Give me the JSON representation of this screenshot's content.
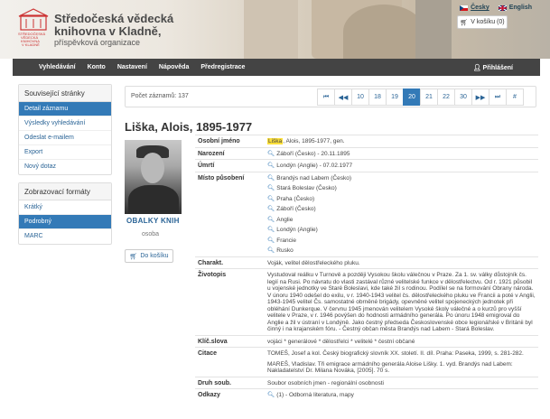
{
  "header": {
    "logo_line1": "Středočeská vědecká",
    "logo_line2": "knihovna v Kladně,",
    "logo_line3": "příspěvková organizace",
    "logo_small": "STŘEDOČESKÁ VĚDECKÁ KNIHOVNA V KLADNĚ",
    "lang_cs": "Česky",
    "lang_en": "English",
    "cart": "V košíku (0)"
  },
  "nav": {
    "items": [
      "Vyhledávání",
      "Konto",
      "Nastavení",
      "Nápověda",
      "Předregistrace"
    ],
    "login": "Přihlášení"
  },
  "sidebar": {
    "related_title": "Související stránky",
    "related": [
      "Detail záznamu",
      "Výsledky vyhledávání",
      "Odeslat e-mailem",
      "Export",
      "Nový dotaz"
    ],
    "formats_title": "Zobrazovací formáty",
    "formats": [
      "Krátký",
      "Podrobný",
      "MARC"
    ]
  },
  "results": {
    "count_text": "Počet záznamů: 137",
    "pages": [
      "10",
      "18",
      "19",
      "20",
      "21",
      "22",
      "30"
    ],
    "current_page": "20",
    "first": "⏮",
    "prev": "◀◀",
    "next": "▶▶",
    "last": "⏭",
    "hash": "#"
  },
  "record": {
    "title": "Liška, Alois, 1895-1977",
    "cover_label": "OBALKY KNIH",
    "type_label": "osoba",
    "add_cart": "Do košíku",
    "fields": {
      "name_label": "Osobní jméno",
      "name_hl": "Liška",
      "name_rest": ", Alois, 1895-1977, gen.",
      "birth_label": "Narození",
      "birth": "Záboří (Česko) - 20.11.1895",
      "death_label": "Úmrtí",
      "death": "Londýn (Anglie) - 07.02.1977",
      "places_label": "Místo působení",
      "places": [
        "Brandýs nad Labem (Česko)",
        "Stará Boleslav (Česko)",
        "Praha (Česko)",
        "Záboří (Česko)",
        "Anglie",
        "Londýn (Anglie)",
        "Francie",
        "Rusko"
      ],
      "charakt_label": "Charakt.",
      "charakt": "Voják, velitel dělostřeleckého pluku.",
      "bio_label": "Životopis",
      "bio": "Vystudoval reálku v Turnově a později Vysokou školu válečnou v Praze. Za 1. sv. války důstojník čs. legií na Rusi. Po návratu do vlasti zastával různé velitelské funkce v dělostřelectvu. Od r. 1921 působil u vojenské jednotky ve Staré Boleslavi, kde také žil s rodinou. Podílel se na formování Obrany národa. V únoru 1940 odešel do exilu, v r. 1940-1943 velitel čs. dělostřeleckého pluku ve Francii a poté v Anglii, 1943-1945 velitel Čs. samostatné obrněné brigády, opevněné velitel spojeneckých jednotek při obléhání Dunkerque. V červnu 1945 jmenován velitelem Vysoké školy válečné a o kurzů pro vyšší velitele v Praze, v r. 1946 povýšen do hodnosti armádního generála. Po únoru 1948 emigroval do Anglie a žil v ústraní v Londýně. Jako čestný předseda Československé obce legionářské v Británii byl činný i na krajanském fóru. - Čestný občan města Brandýs nad Labem - Stará Boleslav.",
      "keywords_label": "Klíč.slova",
      "keywords": "vojáci * generálové * dělostřelci * velitelé * čestní občané",
      "citace_label": "Citace",
      "citace1": "TOMEŠ, Josef a kol. Český biografický slovník XX. století. II. díl. Praha: Paseka, 1999, s. 281-282.",
      "citace2": "MAREŠ, Vladislav. Tři emigrace armádního generála Aloise Lišky. 1. vyd. Brandýs nad Labem: Nakladatelství Dr. Milana Nováka, [2005]. 70 s.",
      "druh_label": "Druh soub.",
      "druh": "Soubor osobních jmen - regionální osobnosti",
      "odkazy_label": "Odkazy",
      "odkazy": "(1) - Odborná literatura, mapy"
    }
  },
  "colors": {
    "accent": "#337ab7",
    "nav": "#444444",
    "highlight": "#fde03a"
  }
}
